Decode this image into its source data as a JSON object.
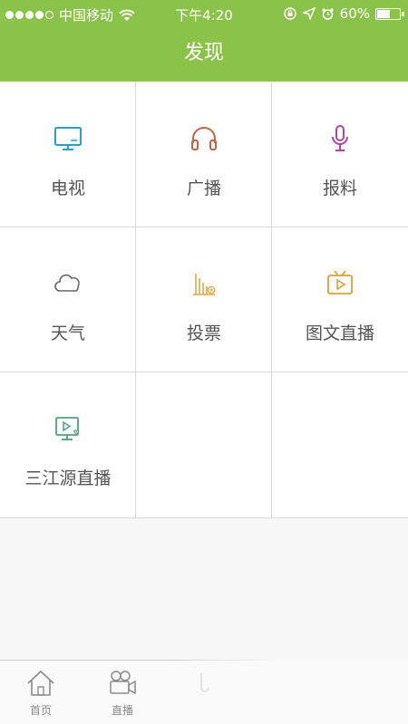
{
  "status_bar": {
    "carrier": "中国移动",
    "time": "下午4:20",
    "battery": "60%",
    "battery_level": 0.6
  },
  "nav": {
    "title": "发现"
  },
  "grid": {
    "items": [
      {
        "label": "电视",
        "icon": "tv-icon",
        "color": "#2aa0c8"
      },
      {
        "label": "广播",
        "icon": "headphones-icon",
        "color": "#c4644a"
      },
      {
        "label": "报料",
        "icon": "microphone-icon",
        "color": "#b0449a"
      },
      {
        "label": "天气",
        "icon": "cloud-icon",
        "color": "#666666"
      },
      {
        "label": "投票",
        "icon": "vote-chart-icon",
        "color": "#e0a848"
      },
      {
        "label": "图文直播",
        "icon": "tv-play-icon",
        "color": "#d9a13a"
      },
      {
        "label": "三江源直播",
        "icon": "video-monitor-icon",
        "color": "#4fa37e"
      }
    ]
  },
  "tabbar": {
    "tabs": [
      {
        "label": "首页",
        "icon": "home-icon"
      },
      {
        "label": "直播",
        "icon": "video-camera-icon"
      },
      {
        "label": "",
        "icon": "partial-icon"
      }
    ]
  }
}
